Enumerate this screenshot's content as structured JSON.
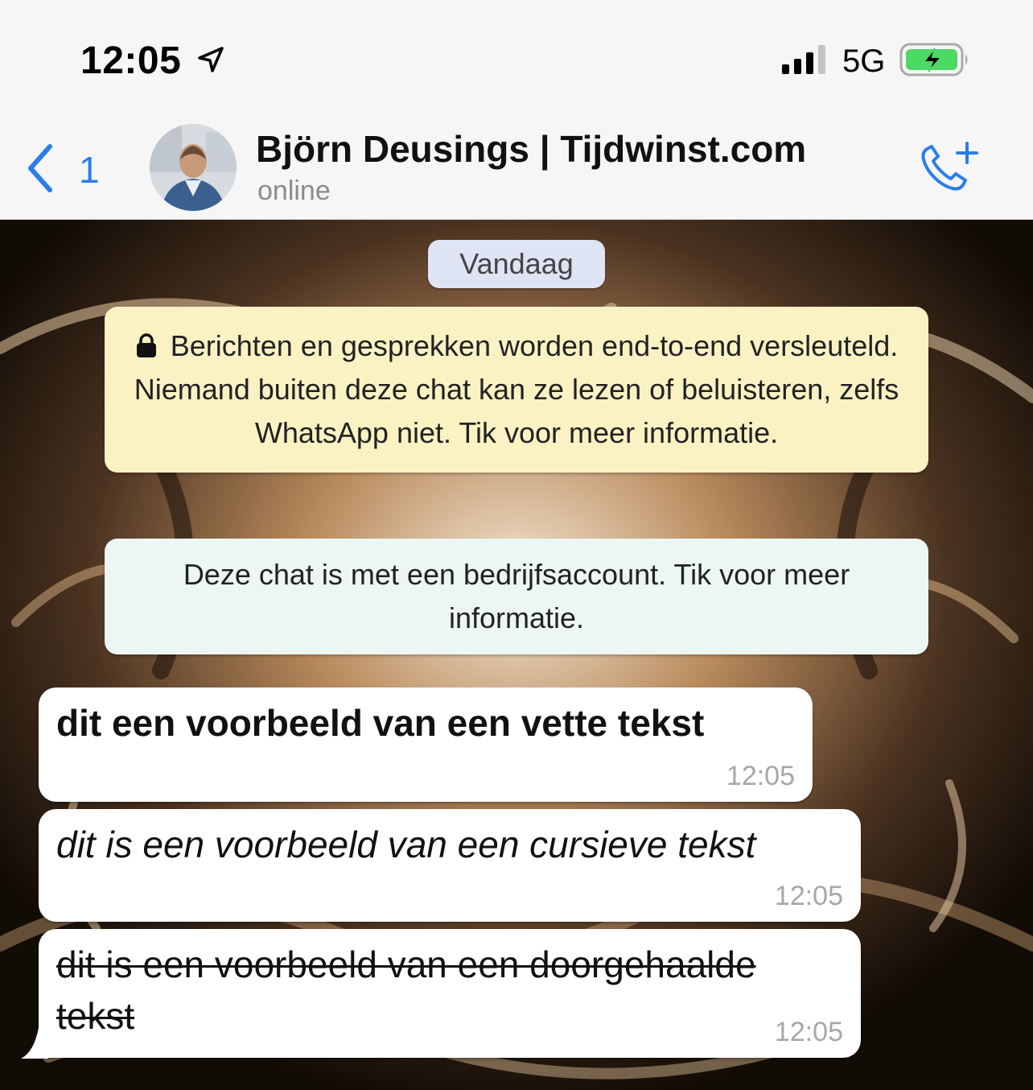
{
  "status_bar": {
    "time": "12:05",
    "network": "5G",
    "location_icon": "location-arrow-icon",
    "signal_icon": "signal-bars-icon",
    "battery_icon": "battery-charging-icon",
    "battery_color": "#4cd964"
  },
  "header": {
    "back_count": "1",
    "contact_name": "Björn Deusings | Tijdwinst.com",
    "contact_status": "online",
    "accent_color": "#2b7de9",
    "call_icon": "add-call-icon"
  },
  "chat": {
    "date_label": "Vandaag",
    "encryption_notice": "Berichten en gesprekken worden end-to-end versleuteld. Niemand buiten deze chat kan ze lezen of beluisteren, zelfs WhatsApp niet. Tik voor meer informatie.",
    "business_notice": "Deze chat is met een bedrijfsaccount. Tik voor meer informatie.",
    "messages": [
      {
        "text": "dit een voorbeeld van een vette tekst",
        "time": "12:05",
        "style": "bold"
      },
      {
        "text": "dit is een voorbeeld van een cursieve tekst",
        "time": "12:05",
        "style": "italic"
      },
      {
        "text": "dit is een voorbeeld van een doorgehaalde tekst",
        "time": "12:05",
        "style": "strikethrough"
      }
    ]
  }
}
